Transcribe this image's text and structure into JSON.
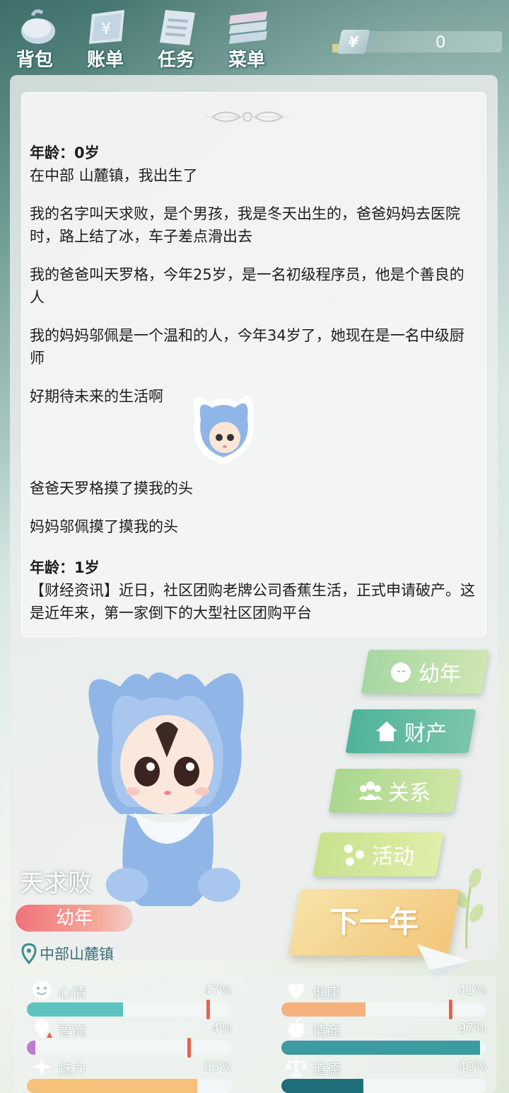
{
  "nav": {
    "items": [
      {
        "label": "背包",
        "icon": "backpack-icon"
      },
      {
        "label": "账单",
        "icon": "bill-icon"
      },
      {
        "label": "任务",
        "icon": "task-icon"
      },
      {
        "label": "菜单",
        "icon": "menu-icon"
      }
    ]
  },
  "money": {
    "symbol": "¥",
    "value": "0"
  },
  "story": {
    "blocks": [
      {
        "age": "年龄：0岁",
        "lines": [
          "在中部 山麓镇，我出生了"
        ]
      },
      {
        "text": "我的名字叫天求败，是个男孩，我是冬天出生的，爸爸妈妈去医院时，路上结了冰，车子差点滑出去"
      },
      {
        "text": "我的爸爸叫天罗格，今年25岁，是一名初级程序员，他是个善良的人"
      },
      {
        "text": "我的妈妈邬佩是一个温和的人，今年34岁了，她现在是一名中级厨师"
      },
      {
        "text": "好期待未来的生活啊"
      },
      {
        "text": "爸爸天罗格摸了摸我的头"
      },
      {
        "text": "妈妈邬佩摸了摸我的头"
      },
      {
        "age": "年龄：1岁",
        "lines": [
          "【财经资讯】近日，社区团购老牌公司香蕉生活，正式申请破产。这是近年来，第一家倒下的大型社区团购平台"
        ]
      }
    ]
  },
  "character": {
    "name": "天求败",
    "stage": "幼年",
    "location": "中部山麓镇"
  },
  "side_buttons": [
    {
      "label": "幼年",
      "icon": "baby-face-icon"
    },
    {
      "label": "财产",
      "icon": "house-icon"
    },
    {
      "label": "关系",
      "icon": "people-icon"
    },
    {
      "label": "活动",
      "icon": "activity-icon"
    }
  ],
  "next_year": {
    "label": "下一年"
  },
  "stats": [
    {
      "label": "心情",
      "value": "47%",
      "fraction": 0.47,
      "color": "#5ec3bf",
      "mark": true,
      "icon": "smile-icon"
    },
    {
      "label": "健康",
      "value": "41%",
      "fraction": 0.41,
      "color": "#f5b27f",
      "mark": true,
      "icon": "heart-icon"
    },
    {
      "label": "智商",
      "value": "4%",
      "fraction": 0.04,
      "color": "#c07bd0",
      "mark": true,
      "icon": "bulb-icon"
    },
    {
      "label": "情商",
      "value": "97%",
      "fraction": 0.97,
      "color": "#3d9aa0",
      "mark": false,
      "icon": "apple-icon"
    },
    {
      "label": "魅力",
      "value": "83%",
      "fraction": 0.83,
      "color": "#f5c27c",
      "mark": false,
      "icon": "sparkle-icon"
    },
    {
      "label": "道德",
      "value": "40%",
      "fraction": 0.4,
      "color": "#1f6f7a",
      "mark": false,
      "icon": "scale-icon"
    }
  ]
}
